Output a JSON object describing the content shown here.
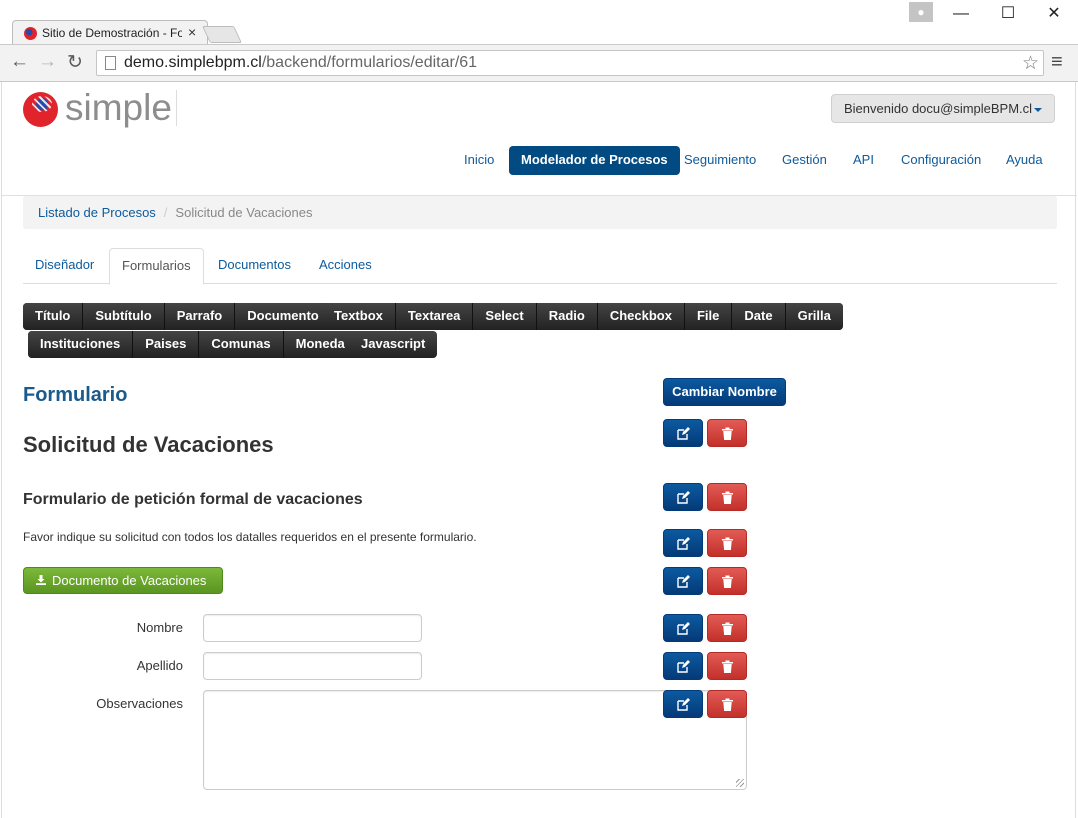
{
  "browser": {
    "tab_title": "Sitio de Demostración - Fo",
    "tab_close": "×",
    "url_host": "demo.simplebpm.cl",
    "url_path": "/backend/formularios/editar/61"
  },
  "header": {
    "logo_text": "simple",
    "user_menu": "Bienvenido docu@simpleBPM.cl"
  },
  "nav": {
    "items": [
      "Inicio",
      "Modelador de Procesos",
      "Seguimiento",
      "Gestión",
      "API",
      "Configuración",
      "Ayuda"
    ]
  },
  "breadcrumb": {
    "parent": "Listado de Procesos",
    "separator": "/",
    "current": "Solicitud de Vacaciones"
  },
  "tabs": [
    "Diseñador",
    "Formularios",
    "Documentos",
    "Acciones"
  ],
  "toolbar": {
    "group1": [
      "Título",
      "Subtítulo",
      "Parrafo",
      "Documento"
    ],
    "group2": [
      "Textbox",
      "Textarea",
      "Select",
      "Radio",
      "Checkbox",
      "File",
      "Date",
      "Grilla"
    ],
    "group3": [
      "Instituciones",
      "Paises",
      "Comunas",
      "Moneda"
    ],
    "group4": [
      "Javascript"
    ]
  },
  "form": {
    "heading": "Formulario",
    "rename_button": "Cambiar Nombre",
    "title": "Solicitud de Vacaciones",
    "subtitle": "Formulario de petición formal de vacaciones",
    "paragraph": "Favor indique su solicitud con todos los datalles requeridos en el presente formulario.",
    "document_button": "Documento de Vacaciones",
    "fields": [
      {
        "label": "Nombre",
        "value": ""
      },
      {
        "label": "Apellido",
        "value": ""
      },
      {
        "label": "Observaciones",
        "value": ""
      }
    ]
  },
  "colors": {
    "primary": "#024a82",
    "danger": "#d9534f",
    "success": "#6aa72d",
    "link": "#0d5a9c"
  },
  "icons": {
    "edit": "edit-icon",
    "delete": "trash-icon",
    "download": "download-icon"
  }
}
